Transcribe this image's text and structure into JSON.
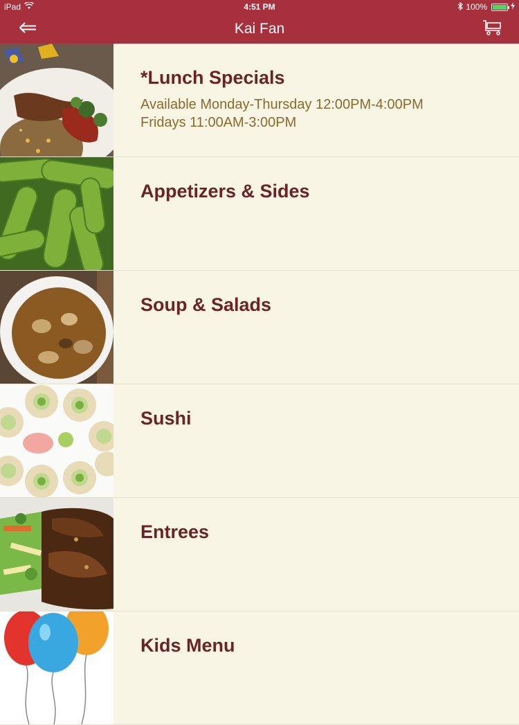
{
  "status": {
    "device": "iPad",
    "time": "4:51 PM",
    "battery": "100%"
  },
  "nav": {
    "title": "Kai Fan",
    "back_icon": "back-arrow-icon",
    "cart_icon": "cart-icon"
  },
  "colors": {
    "brand": "#a7303d",
    "background": "#f8f5e4",
    "title_text": "#6b2228",
    "desc_text": "#8a6a2c"
  },
  "menu": {
    "items": [
      {
        "title": "*Lunch Specials",
        "desc_line1": "Available Monday-Thursday 12:00PM-4:00PM",
        "desc_line2": "Fridays 11:00AM-3:00PM"
      },
      {
        "title": "Appetizers & Sides"
      },
      {
        "title": "Soup & Salads"
      },
      {
        "title": "Sushi"
      },
      {
        "title": "Entrees"
      },
      {
        "title": "Kids Menu"
      }
    ]
  }
}
